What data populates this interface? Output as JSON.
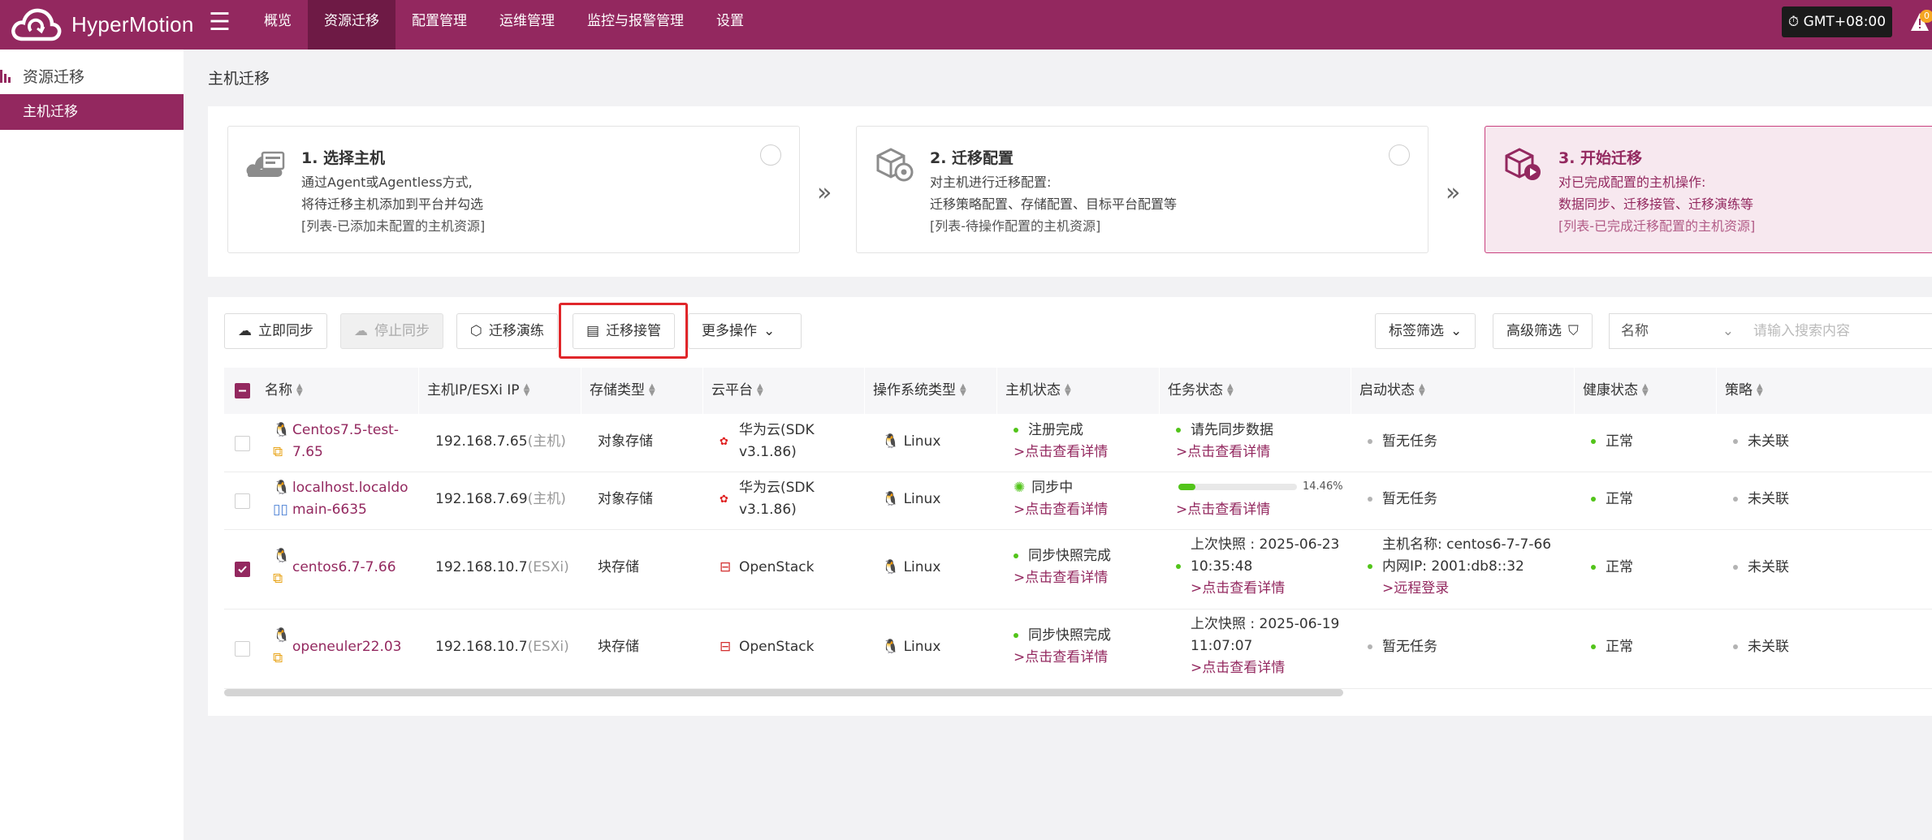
{
  "app": {
    "name": "HyperMotion",
    "timezone": "GMT+08:00",
    "alert_count": "0"
  },
  "nav": [
    "概览",
    "资源迁移",
    "配置管理",
    "运维管理",
    "监控与报警管理",
    "设置"
  ],
  "sidebar": {
    "section": "资源迁移",
    "items": [
      "主机迁移"
    ]
  },
  "page": {
    "title": "主机迁移"
  },
  "steps": [
    {
      "title": "1. 选择主机",
      "lines": [
        "通过Agent或Agentless方式,",
        "将待迁移主机添加到平台并勾选"
      ],
      "note": "[列表-已添加未配置的主机资源]"
    },
    {
      "title": "2. 迁移配置",
      "lines": [
        "对主机进行迁移配置:",
        "迁移策略配置、存储配置、目标平台配置等"
      ],
      "note": "[列表-待操作配置的主机资源]"
    },
    {
      "title": "3. 开始迁移",
      "lines": [
        "对已完成配置的主机操作:",
        "数据同步、迁移接管、迁移演练等"
      ],
      "note": "[列表-已完成迁移配置的主机资源]"
    }
  ],
  "toolbar": {
    "sync_now": "立即同步",
    "stop_sync": "停止同步",
    "drill": "迁移演练",
    "takeover": "迁移接管",
    "more": "更多操作",
    "tag_filter": "标签筛选",
    "advanced_filter": "高级筛选",
    "search_field": "名称",
    "search_placeholder": "请输入搜索内容"
  },
  "columns": [
    "名称",
    "主机IP/ESXi IP",
    "存储类型",
    "云平台",
    "操作系统类型",
    "主机状态",
    "任务状态",
    "启动状态",
    "健康状态",
    "策略"
  ],
  "rows": [
    {
      "checked": false,
      "name1": "Centos7.5-test-",
      "name2": "7.65",
      "ip": "192.168.7.65",
      "ip_tag": "(主机)",
      "storage": "对象存储",
      "cloud1": "华为云(SDK",
      "cloud2": "v3.1.86)",
      "os": "Linux",
      "host_status": "注册完成",
      "host_detail": ">点击查看详情",
      "task1": "请先同步数据",
      "task_link": ">点击查看详情",
      "boot": "暂无任务",
      "health": "正常",
      "policy": "未关联"
    },
    {
      "checked": false,
      "name1": "localhost.localdo",
      "name2": "main-6635",
      "ip": "192.168.7.69",
      "ip_tag": "(主机)",
      "storage": "对象存储",
      "cloud1": "华为云(SDK",
      "cloud2": "v3.1.86)",
      "os": "Linux",
      "host_status": "同步中",
      "host_detail": ">点击查看详情",
      "task_progress": 0.1446,
      "task_percent": "14.46%",
      "task_link": ">点击查看详情",
      "boot": "暂无任务",
      "health": "正常",
      "policy": "未关联"
    },
    {
      "checked": true,
      "name1": "centos6.7-7.66",
      "ip": "192.168.10.7",
      "ip_tag": "(ESXi)",
      "storage": "块存储",
      "cloud1": "OpenStack",
      "os": "Linux",
      "host_status": "同步快照完成",
      "host_detail": ">点击查看详情",
      "task1": "上次快照 : 2025-06-23",
      "task2": "10:35:48",
      "task_link": ">点击查看详情",
      "boot1": "主机名称: centos6-7-7-66",
      "boot2": "内网IP: 2001:db8::32",
      "boot_link": ">远程登录",
      "health": "正常",
      "policy": "未关联"
    },
    {
      "checked": false,
      "name1": "openeuler22.03",
      "ip": "192.168.10.7",
      "ip_tag": "(ESXi)",
      "storage": "块存储",
      "cloud1": "OpenStack",
      "os": "Linux",
      "host_status": "同步快照完成",
      "host_detail": ">点击查看详情",
      "task1": "上次快照 : 2025-06-19",
      "task2": "11:07:07",
      "task_link": ">点击查看详情",
      "boot": "暂无任务",
      "health": "正常",
      "policy": "未关联"
    }
  ],
  "colors": {
    "brand": "#93285f",
    "highlight": "#e0262a",
    "ok": "#52c41a"
  }
}
